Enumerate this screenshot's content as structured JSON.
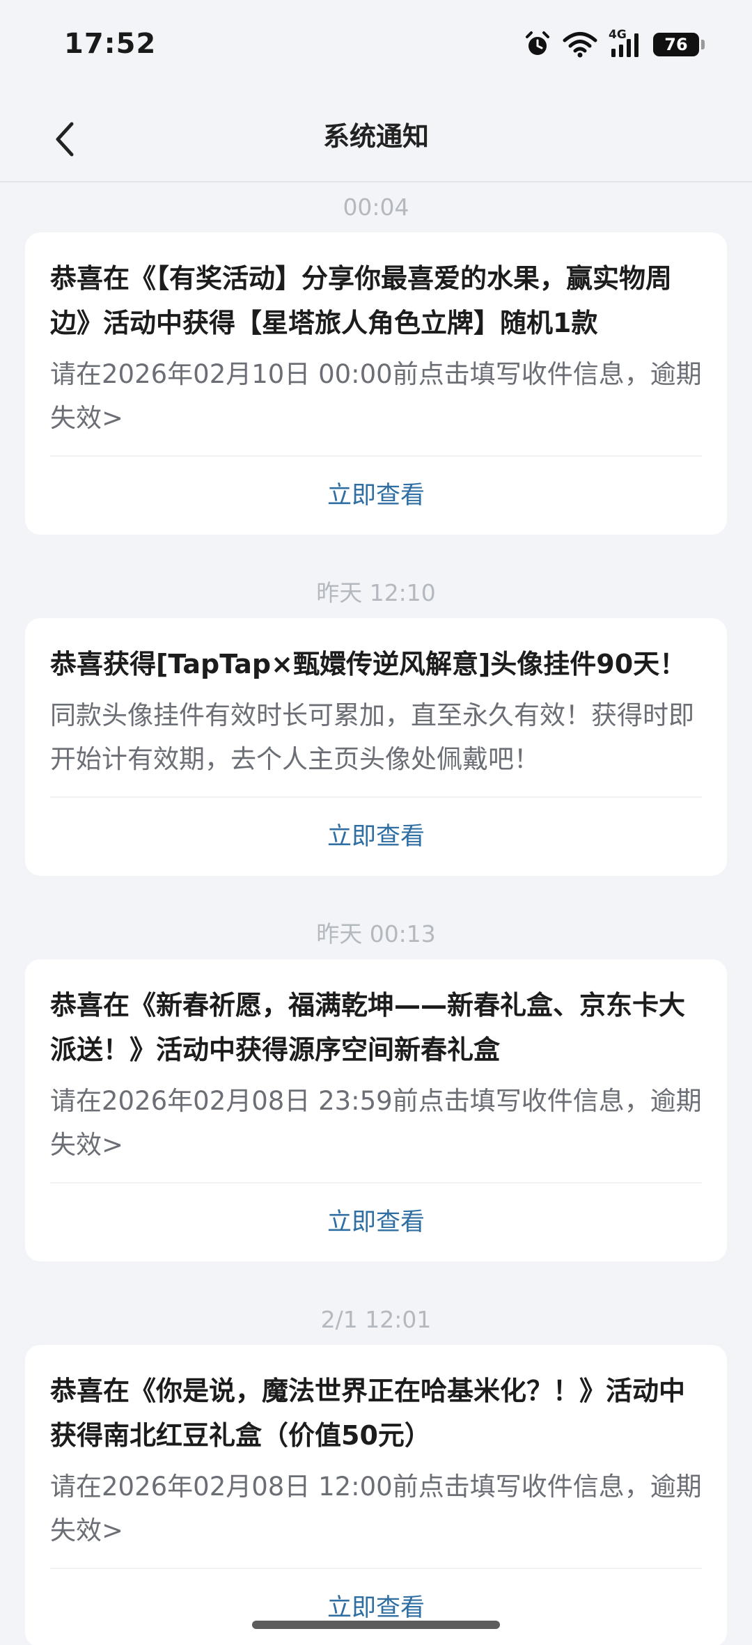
{
  "status_bar": {
    "time": "17:52",
    "network": "4G",
    "battery_level": "76",
    "icons": [
      "alarm-icon",
      "wifi-icon",
      "signal-icon",
      "battery-icon"
    ]
  },
  "nav": {
    "title": "系统通知",
    "back_icon": "chevron-left-icon"
  },
  "notifications": [
    {
      "time": "00:04",
      "title": "恭喜在《【有奖活动】分享你最喜爱的水果，赢实物周边》活动中获得【星塔旅人角色立牌】随机1款",
      "body": "请在2026年02月10日 00:00前点击填写收件信息，逾期失效>",
      "action": "立即查看"
    },
    {
      "time": "昨天  12:10",
      "title": "恭喜获得[TapTap×甄嬛传逆风解意]头像挂件90天！",
      "body": "同款头像挂件有效时长可累加，直至永久有效！获得时即开始计有效期，去个人主页头像处佩戴吧！",
      "action": "立即查看"
    },
    {
      "time": "昨天  00:13",
      "title": "恭喜在《新春祈愿，福满乾坤——新春礼盒、京东卡大派送！》活动中获得源序空间新春礼盒",
      "body": "请在2026年02月08日 23:59前点击填写收件信息，逾期失效>",
      "action": "立即查看"
    },
    {
      "time": "2/1 12:01",
      "title": "恭喜在《你是说，魔法世界正在哈基米化？！》活动中获得南北红豆礼盒（价值50元）",
      "body": "请在2026年02月08日 12:00前点击填写收件信息，逾期失效>",
      "action": "立即查看"
    }
  ],
  "colors": {
    "background": "#f2f4f7",
    "card": "#ffffff",
    "link": "#2f6ea3",
    "timestamp": "#b4b8bf"
  }
}
